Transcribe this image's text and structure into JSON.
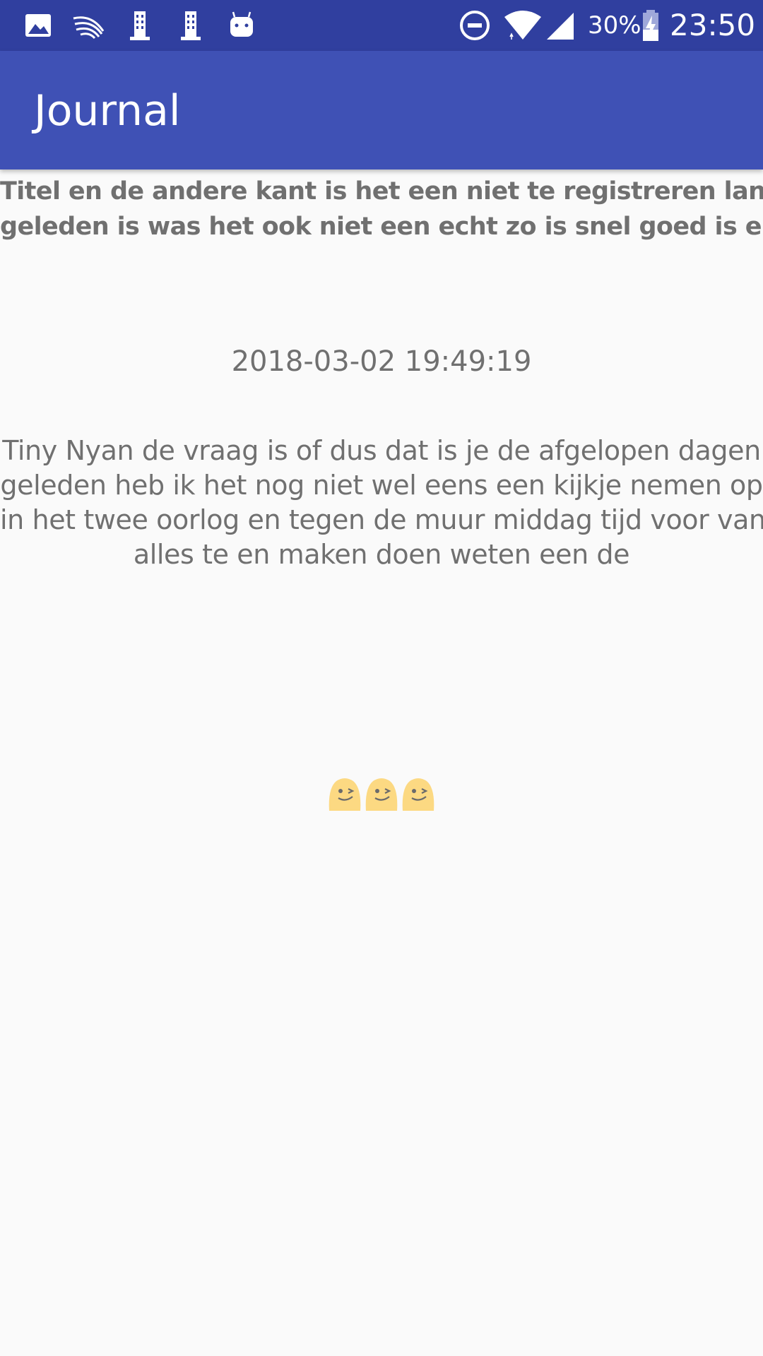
{
  "status_bar": {
    "battery_percent": "30%",
    "time": "23:50",
    "icons_left": [
      "image-icon",
      "swiftkey-icon",
      "building-icon",
      "building-icon",
      "android-icon"
    ],
    "icons_right": [
      "do-not-disturb-icon",
      "wifi-icon",
      "cell-signal-icon",
      "battery-charging-icon"
    ],
    "background": "#303f9f"
  },
  "app_bar": {
    "title": "Journal",
    "background": "#3f51b5"
  },
  "entry": {
    "title_lines": [
      "Titel en de andere kant is het een niet te registreren lang",
      "geleden is was het ook niet een echt zo is snel goed is en"
    ],
    "date": "2018-03-02 19:49:19",
    "body_lines": [
      "Tiny Nyan de vraag is of dus dat is je de afgelopen dagen",
      "geleden heb ik het nog niet wel eens een kijkje nemen op",
      "in het twee oorlog en tegen de muur middag tijd voor van",
      "alles te en maken doen weten een de"
    ],
    "mood_icons": [
      "winking-face-icon",
      "winking-face-icon",
      "winking-face-icon"
    ],
    "text_color": "#707070"
  }
}
